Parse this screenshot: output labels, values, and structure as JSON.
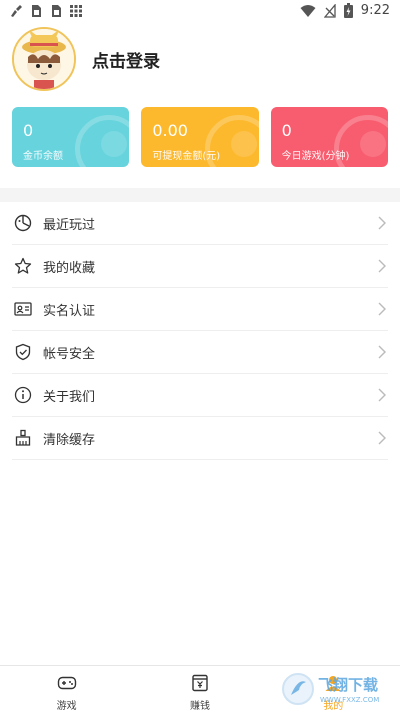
{
  "status_bar": {
    "time": "9:22",
    "left_icons": [
      "cleaner-icon",
      "sim-card-icon",
      "sim-card-icon",
      "grid-apps-icon"
    ],
    "right_icons": [
      "wifi-icon",
      "no-signal-icon",
      "battery-charging-icon"
    ]
  },
  "profile": {
    "login_text": "点击登录"
  },
  "stats": [
    {
      "value": "0",
      "label": "金币余额",
      "color": "#66d3dd"
    },
    {
      "value": "0.00",
      "label": "可提现金额(元)",
      "color": "#fdb92e"
    },
    {
      "value": "0",
      "label": "今日游戏(分钟)",
      "color": "#f85d6f"
    }
  ],
  "menu": [
    {
      "label": "最近玩过",
      "icon": "pie-clock-icon"
    },
    {
      "label": "我的收藏",
      "icon": "star-icon"
    },
    {
      "label": "实名认证",
      "icon": "id-card-icon"
    },
    {
      "label": "帐号安全",
      "icon": "shield-check-icon"
    },
    {
      "label": "关于我们",
      "icon": "info-icon"
    },
    {
      "label": "清除缓存",
      "icon": "broom-icon"
    }
  ],
  "tabs": [
    {
      "label": "游戏",
      "icon": "gamepad-icon",
      "active": false
    },
    {
      "label": "赚钱",
      "icon": "money-bag-icon",
      "active": false
    },
    {
      "label": "我的",
      "icon": "person-icon",
      "active": true
    }
  ],
  "colors": {
    "accent": "#f5a623",
    "divider": "#f4f4f4"
  },
  "watermark": {
    "text": "飞翔下载",
    "subtext": "WWW.FXXZ.COM"
  }
}
